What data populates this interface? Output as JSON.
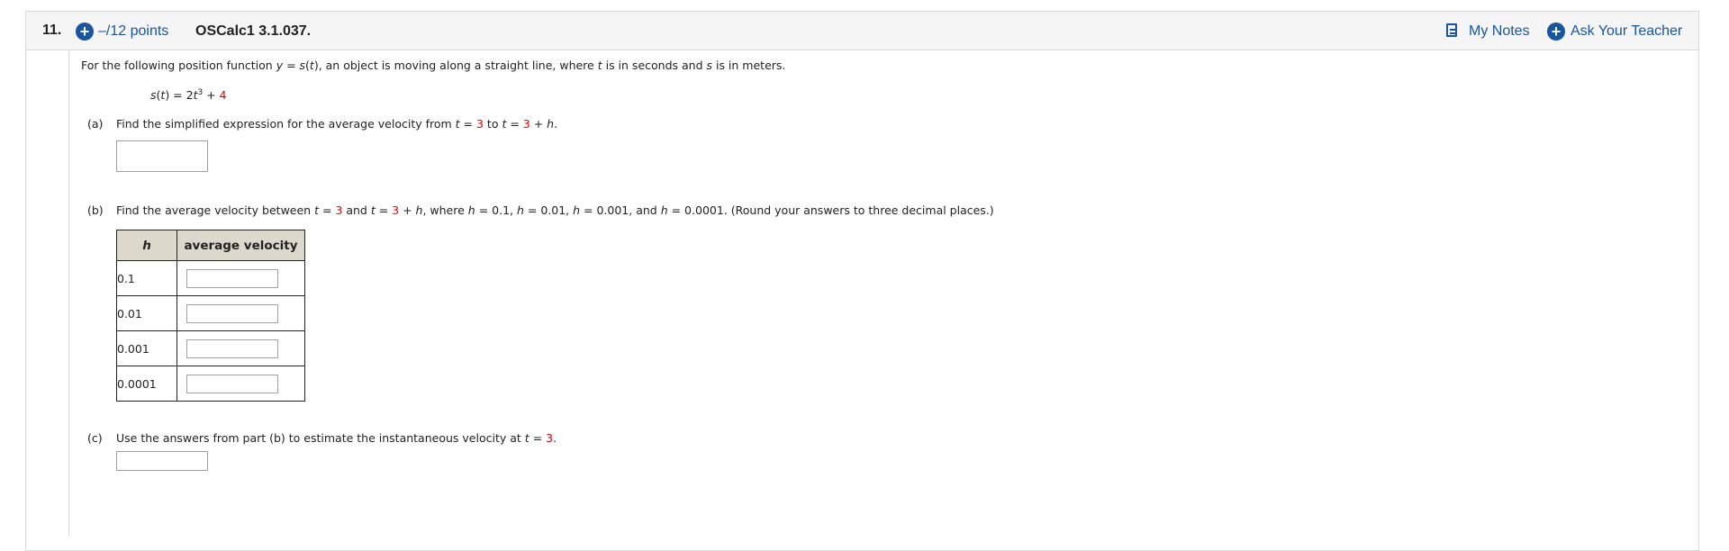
{
  "header": {
    "question_number": "11.",
    "plus_icon": "plus-circle-icon",
    "points": "–/12 points",
    "source": "OSCalc1 3.1.037.",
    "my_notes": "My Notes",
    "ask_teacher": "Ask Your Teacher",
    "accent_color": "#1a56a0"
  },
  "question": {
    "intro": {
      "a": "For the following position function ",
      "b": "y",
      "c": " = ",
      "d": "s",
      "e": "(",
      "f": "t",
      "g": "), an object is moving along a straight line, where ",
      "h": "t",
      "i": " is in seconds and ",
      "j": "s",
      "k": " is in meters."
    },
    "formula": {
      "s": "s",
      "lp": "(",
      "t": "t",
      "rp": ") = 2",
      "t2": "t",
      "exp": "3",
      "plus": " + ",
      "const": "4"
    },
    "part_a": {
      "label": "(a)",
      "p1": "Find the simplified expression for the average velocity from ",
      "t1": "t",
      "p2": " = ",
      "v1": "3",
      "p3": " to ",
      "t2": "t",
      "p4": " = ",
      "v2": "3",
      "p5": " + ",
      "h": "h",
      "p6": "."
    },
    "part_b": {
      "label": "(b)",
      "p1": "Find the average velocity between ",
      "t1": "t",
      "p2": " = ",
      "v1": "3",
      "p3": " and ",
      "t2": "t",
      "p4": " = ",
      "v2": "3",
      "p5": " + ",
      "h1": "h",
      "p6": ", where ",
      "h2": "h",
      "p7": " = 0.1, ",
      "h3": "h",
      "p8": " = 0.01, ",
      "h4": "h",
      "p9": " = 0.001, and ",
      "h5": "h",
      "p10": " = 0.0001. (Round your answers to three decimal places.)"
    },
    "table": {
      "header_h": "h",
      "header_v": "average velocity",
      "rows": [
        "0.1",
        "0.01",
        "0.001",
        "0.0001"
      ]
    },
    "part_c": {
      "label": "(c)",
      "p1": "Use the answers from part (b) to estimate the instantaneous velocity at ",
      "t": "t",
      "p2": " = ",
      "v": "3",
      "p3": "."
    },
    "highlight_color": "#e00000"
  }
}
